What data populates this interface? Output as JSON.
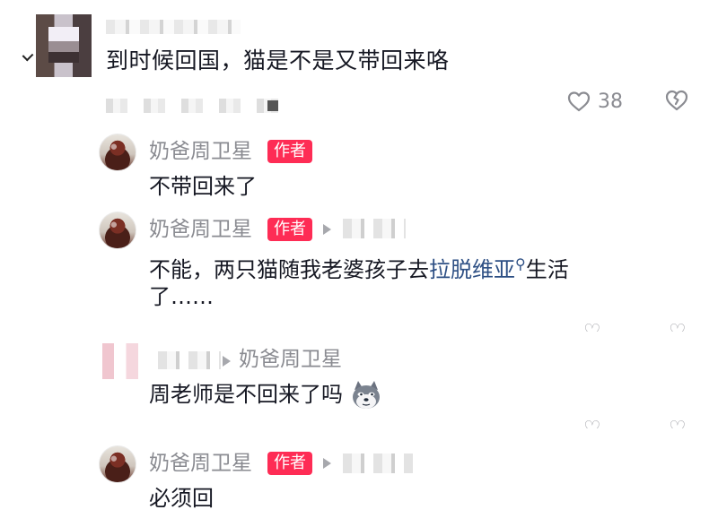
{
  "top_comment": {
    "text": "到时候回国，猫是不是又带回来咯",
    "likes": "38"
  },
  "replies": [
    {
      "author": "奶爸周卫星",
      "badge": "作者",
      "text": "不带回来了"
    },
    {
      "author": "奶爸周卫星",
      "badge": "作者",
      "text_before_link": "不能，两只猫随我老婆孩子去",
      "link": "拉脱维亚",
      "text_after_link": "生活",
      "text_line2": "了……"
    },
    {
      "reply_to": "奶爸周卫星",
      "text": "周老师是不回来了吗"
    },
    {
      "author": "奶爸周卫星",
      "badge": "作者",
      "text": "必须回"
    }
  ],
  "icons": {
    "like": "heart-outline-icon",
    "dislike": "broken-heart-icon",
    "search": "search-icon",
    "emoji": "doge-emoji-icon"
  },
  "colors": {
    "text": "#161823",
    "secondary": "#8a8b91",
    "badge": "#fe2c55",
    "link": "#2d4f84"
  }
}
